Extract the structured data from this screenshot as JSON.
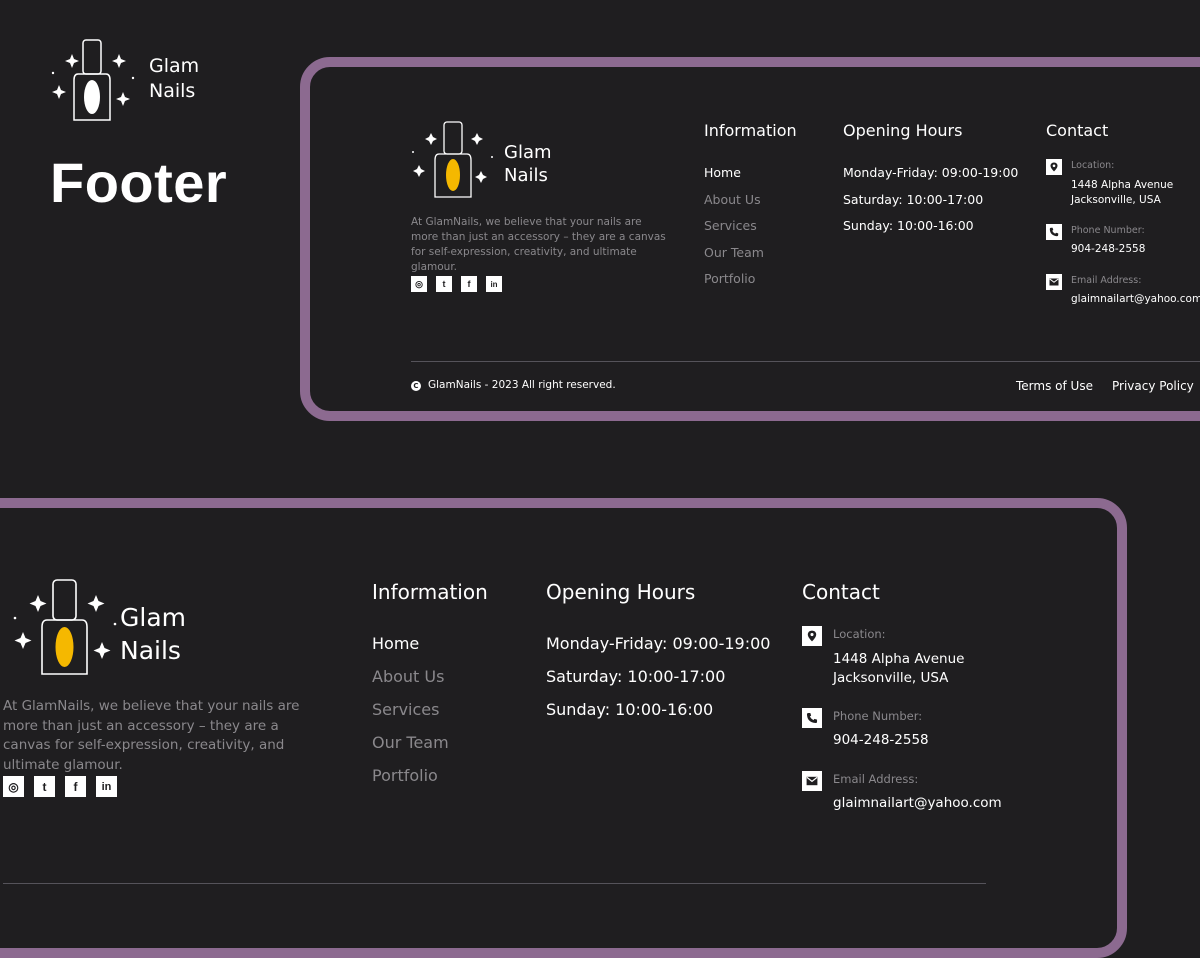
{
  "page": {
    "heading": "Footer"
  },
  "brand": {
    "line1": "Glam",
    "line2": "Nails"
  },
  "footer": {
    "description": "At GlamNails, we believe that your nails are more than just an accessory – they are a canvas for self-expression, creativity, and ultimate glamour.",
    "social": [
      "instagram-icon",
      "twitter-icon",
      "facebook-icon",
      "linkedin-icon"
    ],
    "information": {
      "title": "Information",
      "links": [
        "Home",
        "About Us",
        "Services",
        "Our Team",
        "Portfolio"
      ]
    },
    "hours": {
      "title": "Opening Hours",
      "items": [
        "Monday-Friday: 09:00-19:00",
        "Saturday: 10:00-17:00",
        "Sunday: 10:00-16:00"
      ]
    },
    "contact": {
      "title": "Contact",
      "location_label": "Location:",
      "location_value": "1448 Alpha Avenue\nJacksonville, USA",
      "phone_label": "Phone Number:",
      "phone_value": "904-248-2558",
      "email_label": "Email Address:",
      "email_value": "glaimnailart@yahoo.com"
    },
    "copyright": "GlamNails - 2023 All right reserved.",
    "copyright_symbol": "C",
    "terms": "Terms of Use",
    "privacy": "Privacy Policy"
  },
  "colors": {
    "background": "#1f1e20",
    "frame": "#8c6a90",
    "accent_nail": "#f5b800",
    "muted_text": "#8a888c"
  }
}
